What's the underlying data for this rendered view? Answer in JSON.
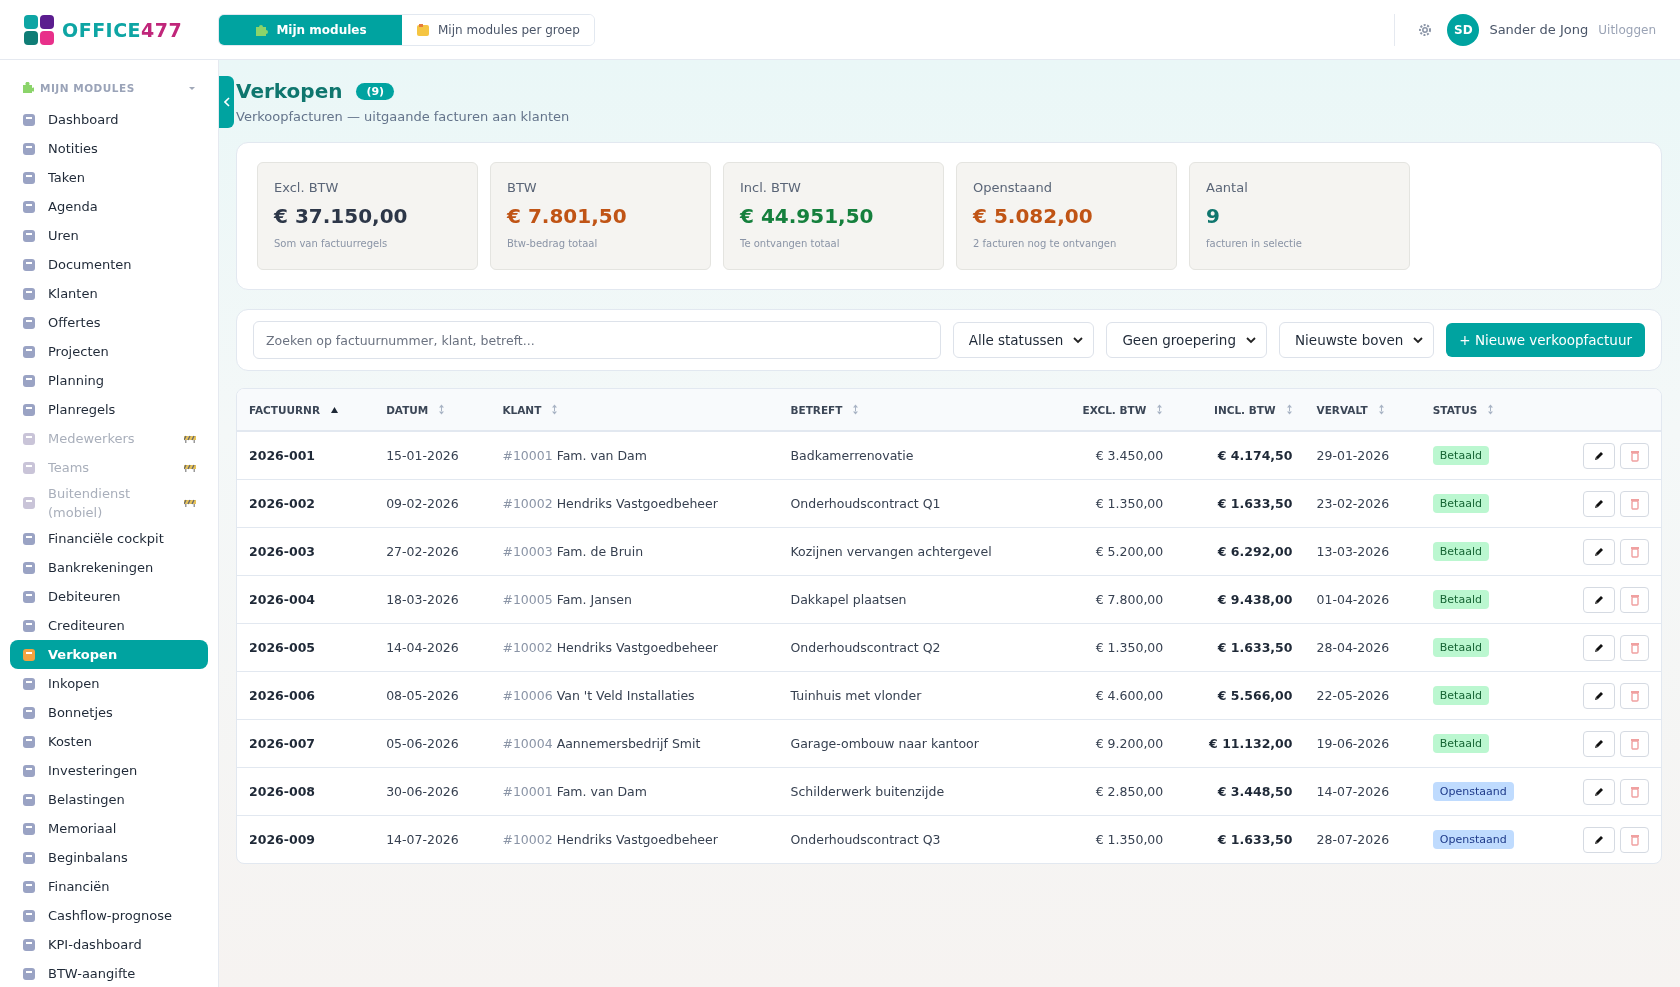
{
  "brand": {
    "name": "OFFICE",
    "number": "477"
  },
  "top_tabs": [
    {
      "label": "Mijn modules",
      "selected": true
    },
    {
      "label": "Mijn modules per groep",
      "selected": false
    }
  ],
  "user": {
    "initials": "SD",
    "name": "Sander de Jong",
    "logout": "Uitloggen"
  },
  "sidebar": {
    "section": "MIJN MODULES",
    "items": [
      {
        "label": "Dashboard",
        "selected": false,
        "disabled": false
      },
      {
        "label": "Notities",
        "selected": false,
        "disabled": false
      },
      {
        "label": "Taken",
        "selected": false,
        "disabled": false
      },
      {
        "label": "Agenda",
        "selected": false,
        "disabled": false
      },
      {
        "label": "Uren",
        "selected": false,
        "disabled": false
      },
      {
        "label": "Documenten",
        "selected": false,
        "disabled": false
      },
      {
        "label": "Klanten",
        "selected": false,
        "disabled": false
      },
      {
        "label": "Offertes",
        "selected": false,
        "disabled": false
      },
      {
        "label": "Projecten",
        "selected": false,
        "disabled": false
      },
      {
        "label": "Planning",
        "selected": false,
        "disabled": false
      },
      {
        "label": "Planregels",
        "selected": false,
        "disabled": false
      },
      {
        "label": "Medewerkers",
        "selected": false,
        "disabled": true
      },
      {
        "label": "Teams",
        "selected": false,
        "disabled": true
      },
      {
        "label": "Buitendienst (mobiel)",
        "selected": false,
        "disabled": true
      },
      {
        "label": "Financiële cockpit",
        "selected": false,
        "disabled": false
      },
      {
        "label": "Bankrekeningen",
        "selected": false,
        "disabled": false
      },
      {
        "label": "Debiteuren",
        "selected": false,
        "disabled": false
      },
      {
        "label": "Crediteuren",
        "selected": false,
        "disabled": false
      },
      {
        "label": "Verkopen",
        "selected": true,
        "disabled": false
      },
      {
        "label": "Inkopen",
        "selected": false,
        "disabled": false
      },
      {
        "label": "Bonnetjes",
        "selected": false,
        "disabled": false
      },
      {
        "label": "Kosten",
        "selected": false,
        "disabled": false
      },
      {
        "label": "Investeringen",
        "selected": false,
        "disabled": false
      },
      {
        "label": "Belastingen",
        "selected": false,
        "disabled": false
      },
      {
        "label": "Memoriaal",
        "selected": false,
        "disabled": false
      },
      {
        "label": "Beginbalans",
        "selected": false,
        "disabled": false
      },
      {
        "label": "Financiën",
        "selected": false,
        "disabled": false
      },
      {
        "label": "Cashflow-prognose",
        "selected": false,
        "disabled": false
      },
      {
        "label": "KPI-dashboard",
        "selected": false,
        "disabled": false
      },
      {
        "label": "BTW-aangifte",
        "selected": false,
        "disabled": false
      }
    ]
  },
  "page": {
    "title": "Verkopen",
    "count": "(9)",
    "subtitle": "Verkoopfacturen — uitgaande facturen aan klanten"
  },
  "stats": [
    {
      "label": "Excl. BTW",
      "value": "€ 37.150,00",
      "note": "Som van factuurregels",
      "color": "#2d3748"
    },
    {
      "label": "BTW",
      "value": "€ 7.801,50",
      "note": "Btw-bedrag totaal",
      "color": "#c05415"
    },
    {
      "label": "Incl. BTW",
      "value": "€ 44.951,50",
      "note": "Te ontvangen totaal",
      "color": "#15803d"
    },
    {
      "label": "Openstaand",
      "value": "€ 5.082,00",
      "note": "2 facturen nog te ontvangen",
      "color": "#c05415"
    },
    {
      "label": "Aantal",
      "value": "9",
      "note": "facturen in selectie",
      "color": "#0f766e"
    }
  ],
  "toolbar": {
    "search": {
      "placeholder": "Zoeken op factuurnummer, klant, betreft..."
    },
    "filters": [
      "Alle statussen",
      "Geen groepering",
      "Nieuwste boven"
    ],
    "new_button": "+ Nieuwe verkoopfactuur"
  },
  "table": {
    "columns": [
      {
        "label": "FACTUURNR",
        "sorted": true,
        "numeric": false
      },
      {
        "label": "DATUM",
        "sorted": false,
        "numeric": false
      },
      {
        "label": "KLANT",
        "sorted": false,
        "numeric": false
      },
      {
        "label": "BETREFT",
        "sorted": false,
        "numeric": false
      },
      {
        "label": "EXCL. BTW",
        "sorted": false,
        "numeric": true
      },
      {
        "label": "INCL. BTW",
        "sorted": false,
        "numeric": true
      },
      {
        "label": "VERVALT",
        "sorted": false,
        "numeric": false
      },
      {
        "label": "STATUS",
        "sorted": false,
        "numeric": false
      }
    ],
    "rows": [
      {
        "number": "2026-001",
        "date": "15-01-2026",
        "client_id": "#10001",
        "client": "Fam. van Dam",
        "subject": "Badkamerrenovatie",
        "excl": "€ 3.450,00",
        "incl": "€ 4.174,50",
        "due": "29-01-2026",
        "status": "Betaald",
        "paid": true
      },
      {
        "number": "2026-002",
        "date": "09-02-2026",
        "client_id": "#10002",
        "client": "Hendriks Vastgoedbeheer",
        "subject": "Onderhoudscontract Q1",
        "excl": "€ 1.350,00",
        "incl": "€ 1.633,50",
        "due": "23-02-2026",
        "status": "Betaald",
        "paid": true
      },
      {
        "number": "2026-003",
        "date": "27-02-2026",
        "client_id": "#10003",
        "client": "Fam. de Bruin",
        "subject": "Kozijnen vervangen achtergevel",
        "excl": "€ 5.200,00",
        "incl": "€ 6.292,00",
        "due": "13-03-2026",
        "status": "Betaald",
        "paid": true
      },
      {
        "number": "2026-004",
        "date": "18-03-2026",
        "client_id": "#10005",
        "client": "Fam. Jansen",
        "subject": "Dakkapel plaatsen",
        "excl": "€ 7.800,00",
        "incl": "€ 9.438,00",
        "due": "01-04-2026",
        "status": "Betaald",
        "paid": true
      },
      {
        "number": "2026-005",
        "date": "14-04-2026",
        "client_id": "#10002",
        "client": "Hendriks Vastgoedbeheer",
        "subject": "Onderhoudscontract Q2",
        "excl": "€ 1.350,00",
        "incl": "€ 1.633,50",
        "due": "28-04-2026",
        "status": "Betaald",
        "paid": true
      },
      {
        "number": "2026-006",
        "date": "08-05-2026",
        "client_id": "#10006",
        "client": "Van 't Veld Installaties",
        "subject": "Tuinhuis met vlonder",
        "excl": "€ 4.600,00",
        "incl": "€ 5.566,00",
        "due": "22-05-2026",
        "status": "Betaald",
        "paid": true
      },
      {
        "number": "2026-007",
        "date": "05-06-2026",
        "client_id": "#10004",
        "client": "Aannemersbedrijf Smit",
        "subject": "Garage-ombouw naar kantoor",
        "excl": "€ 9.200,00",
        "incl": "€ 11.132,00",
        "due": "19-06-2026",
        "status": "Betaald",
        "paid": true
      },
      {
        "number": "2026-008",
        "date": "30-06-2026",
        "client_id": "#10001",
        "client": "Fam. van Dam",
        "subject": "Schilderwerk buitenzijde",
        "excl": "€ 2.850,00",
        "incl": "€ 3.448,50",
        "due": "14-07-2026",
        "status": "Openstaand",
        "paid": false
      },
      {
        "number": "2026-009",
        "date": "14-07-2026",
        "client_id": "#10002",
        "client": "Hendriks Vastgoedbeheer",
        "subject": "Onderhoudscontract Q3",
        "excl": "€ 1.350,00",
        "incl": "€ 1.633,50",
        "due": "28-07-2026",
        "status": "Openstaand",
        "paid": false
      }
    ]
  }
}
